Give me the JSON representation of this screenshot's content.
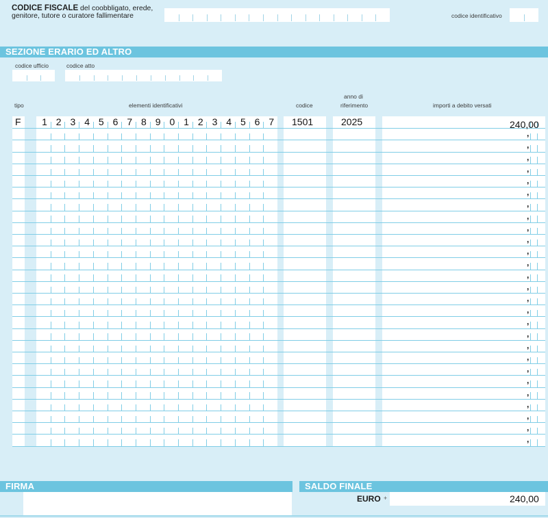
{
  "header": {
    "cf_bold": "CODICE FISCALE",
    "cf_rest": " del coobbligato, erede, genitore, tutore o curatore fallimentare",
    "codice_identificativo_label": "codice identificativo"
  },
  "sezione": {
    "title": "SEZIONE ERARIO ED ALTRO",
    "codice_ufficio_label": "codice ufficio",
    "codice_atto_label": "codice atto"
  },
  "columns": {
    "tipo": "tipo",
    "elementi": "elementi identificativi",
    "codice": "codice",
    "anno_line1": "anno di",
    "anno_line2": "riferimento",
    "importi": "importi a debito versati"
  },
  "first_row": {
    "tipo": "F",
    "elementi_digits": [
      "1",
      "2",
      "3",
      "4",
      "5",
      "6",
      "7",
      "8",
      "9",
      "0",
      "1",
      "2",
      "3",
      "4",
      "5",
      "6",
      "7"
    ],
    "codice": "1501",
    "anno": "2025",
    "importo": "240,00"
  },
  "empty_row_count": 27,
  "empty_row_comma": ",",
  "footer": {
    "firma_label": "FIRMA",
    "saldo_label": "SALDO FINALE",
    "euro_label": "EURO",
    "plus_sign": "+",
    "saldo_value": "240,00"
  }
}
